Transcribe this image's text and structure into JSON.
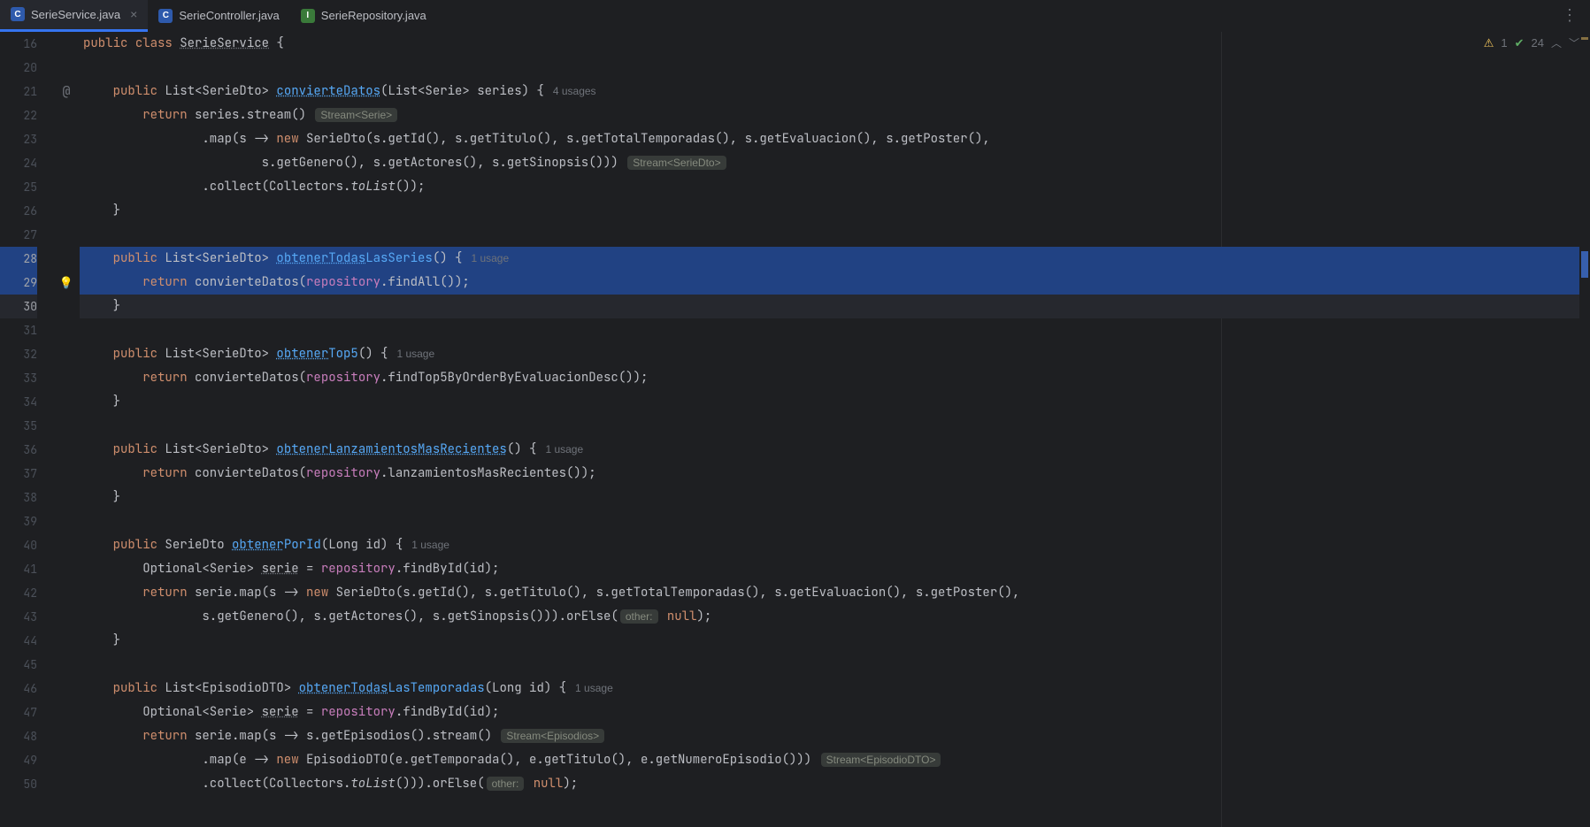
{
  "tabs": [
    {
      "name": "SerieService.java",
      "iconLetter": "C",
      "iconClass": "ic-c",
      "active": true,
      "closable": true
    },
    {
      "name": "SerieController.java",
      "iconLetter": "C",
      "iconClass": "ic-c",
      "active": false,
      "closable": false
    },
    {
      "name": "SerieRepository.java",
      "iconLetter": "I",
      "iconClass": "ic-i",
      "active": false,
      "closable": false
    }
  ],
  "inspection": {
    "warnings": "1",
    "passed": "24"
  },
  "gutter": {
    "start": 16,
    "lines": [
      "16",
      "20",
      "21",
      "22",
      "23",
      "24",
      "25",
      "26",
      "27",
      "28",
      "29",
      "30",
      "31",
      "32",
      "33",
      "34",
      "35",
      "36",
      "37",
      "38",
      "39",
      "40",
      "41",
      "42",
      "43",
      "44",
      "45",
      "46",
      "47",
      "48",
      "49",
      "50"
    ],
    "selected": [
      "28",
      "29",
      "30"
    ],
    "current": "30",
    "overrideAt": "21",
    "bulbAt": "29"
  },
  "code": {
    "l16": {
      "pre": "",
      "kw1": "public",
      "sp1": " ",
      "kw2": "class",
      "sp2": " ",
      "cls": "SerieService",
      "rest": " {"
    },
    "l21": {
      "pre": "    ",
      "kw": "public",
      "type": " List<SerieDto> ",
      "fn": "convierteDatos",
      "sig": "(List<Serie> series) {",
      "usages": "4 usages"
    },
    "l22": {
      "pre": "        ",
      "kw": "return",
      "txt": " series.stream()",
      "hint": "Stream<Serie>"
    },
    "l23": {
      "pre": "                ",
      "txt1": ".map(s -> ",
      "kw": "new",
      "txt2": " SerieDto(s.getId(), s.getTitulo(), s.getTotalTemporadas(), s.getEvaluacion(), s.getPoster(),"
    },
    "l24": {
      "pre": "                        ",
      "txt": "s.getGenero(), s.getActores(), s.getSinopsis()))",
      "hint": "Stream<SerieDto>"
    },
    "l25": {
      "pre": "                ",
      "txt1": ".collect(Collectors.",
      "ital": "toList",
      "txt2": "());"
    },
    "l26": {
      "pre": "    ",
      "txt": "}"
    },
    "l28": {
      "pre": "    ",
      "kw": "public",
      "type": " List<SerieDto> ",
      "fn1": "obtenerTodas",
      "fn2": "LasSeries",
      "sig": "() {",
      "usages": "1 usage"
    },
    "l29": {
      "pre": "        ",
      "kw": "return",
      "txt1": " convierteDatos(",
      "fld": "repository",
      "txt2": ".findAll());"
    },
    "l30": {
      "pre": "    ",
      "txt": "}"
    },
    "l32": {
      "pre": "    ",
      "kw": "public",
      "type": " List<SerieDto> ",
      "fn1": "obtener",
      "fn2": "Top5",
      "sig": "() {",
      "usages": "1 usage"
    },
    "l33": {
      "pre": "        ",
      "kw": "return",
      "txt1": " convierteDatos(",
      "fld": "repository",
      "txt2": ".findTop5ByOrderByEvaluacionDesc());"
    },
    "l34": {
      "pre": "    ",
      "txt": "}"
    },
    "l36": {
      "pre": "    ",
      "kw": "public",
      "type": " List<SerieDto> ",
      "fn1": "obtenerLanzamientosMasRecientes",
      "sig": "() {",
      "usages": "1 usage"
    },
    "l37": {
      "pre": "        ",
      "kw": "return",
      "txt1": " convierteDatos(",
      "fld": "repository",
      "txt2": ".lanzamientosMasRecientes());"
    },
    "l38": {
      "pre": "    ",
      "txt": "}"
    },
    "l40": {
      "pre": "    ",
      "kw": "public",
      "type": " SerieDto ",
      "fn1": "obtener",
      "fn2": "PorId",
      "sig": "(Long id) {",
      "usages": "1 usage"
    },
    "l41": {
      "pre": "        ",
      "txt1": "Optional<Serie> ",
      "var": "serie",
      "txt2": " = ",
      "fld": "repository",
      "txt3": ".findById(id);"
    },
    "l42": {
      "pre": "        ",
      "kw": "return",
      "txt1": " serie.map(s -> ",
      "kw2": "new",
      "txt2": " SerieDto(s.getId(), s.getTitulo(), s.getTotalTemporadas(), s.getEvaluacion(), s.getPoster(),"
    },
    "l43": {
      "pre": "                ",
      "txt1": "s.getGenero(), s.getActores(), s.getSinopsis())).orElse(",
      "hint": "other:",
      "sp": " ",
      "kw": "null",
      "txt2": ");"
    },
    "l44": {
      "pre": "    ",
      "txt": "}"
    },
    "l46": {
      "pre": "    ",
      "kw": "public",
      "type": " List<EpisodioDTO> ",
      "fn1": "obtenerTodas",
      "fn2": "LasTemporadas",
      "sig": "(Long id) {",
      "usages": "1 usage"
    },
    "l47": {
      "pre": "        ",
      "txt1": "Optional<Serie> ",
      "var": "serie",
      "txt2": " = ",
      "fld": "repository",
      "txt3": ".findById(id);"
    },
    "l48": {
      "pre": "        ",
      "kw": "return",
      "txt1": " serie.map(s -> s.getEpisodios().stream()",
      "hint": "Stream<Episodios>"
    },
    "l49": {
      "pre": "                ",
      "txt1": ".map(e -> ",
      "kw": "new",
      "txt2": " EpisodioDTO(e.getTemporada(), e.getTitulo(), e.getNumeroEpisodio()))",
      "hint": "Stream<EpisodioDTO>"
    },
    "l50": {
      "pre": "                ",
      "txt1": ".collect(Collectors.",
      "ital": "toList",
      "txt2": "())).orElse(",
      "hint": "other:",
      "sp": " ",
      "kw": "null",
      "txt3": ");"
    }
  }
}
